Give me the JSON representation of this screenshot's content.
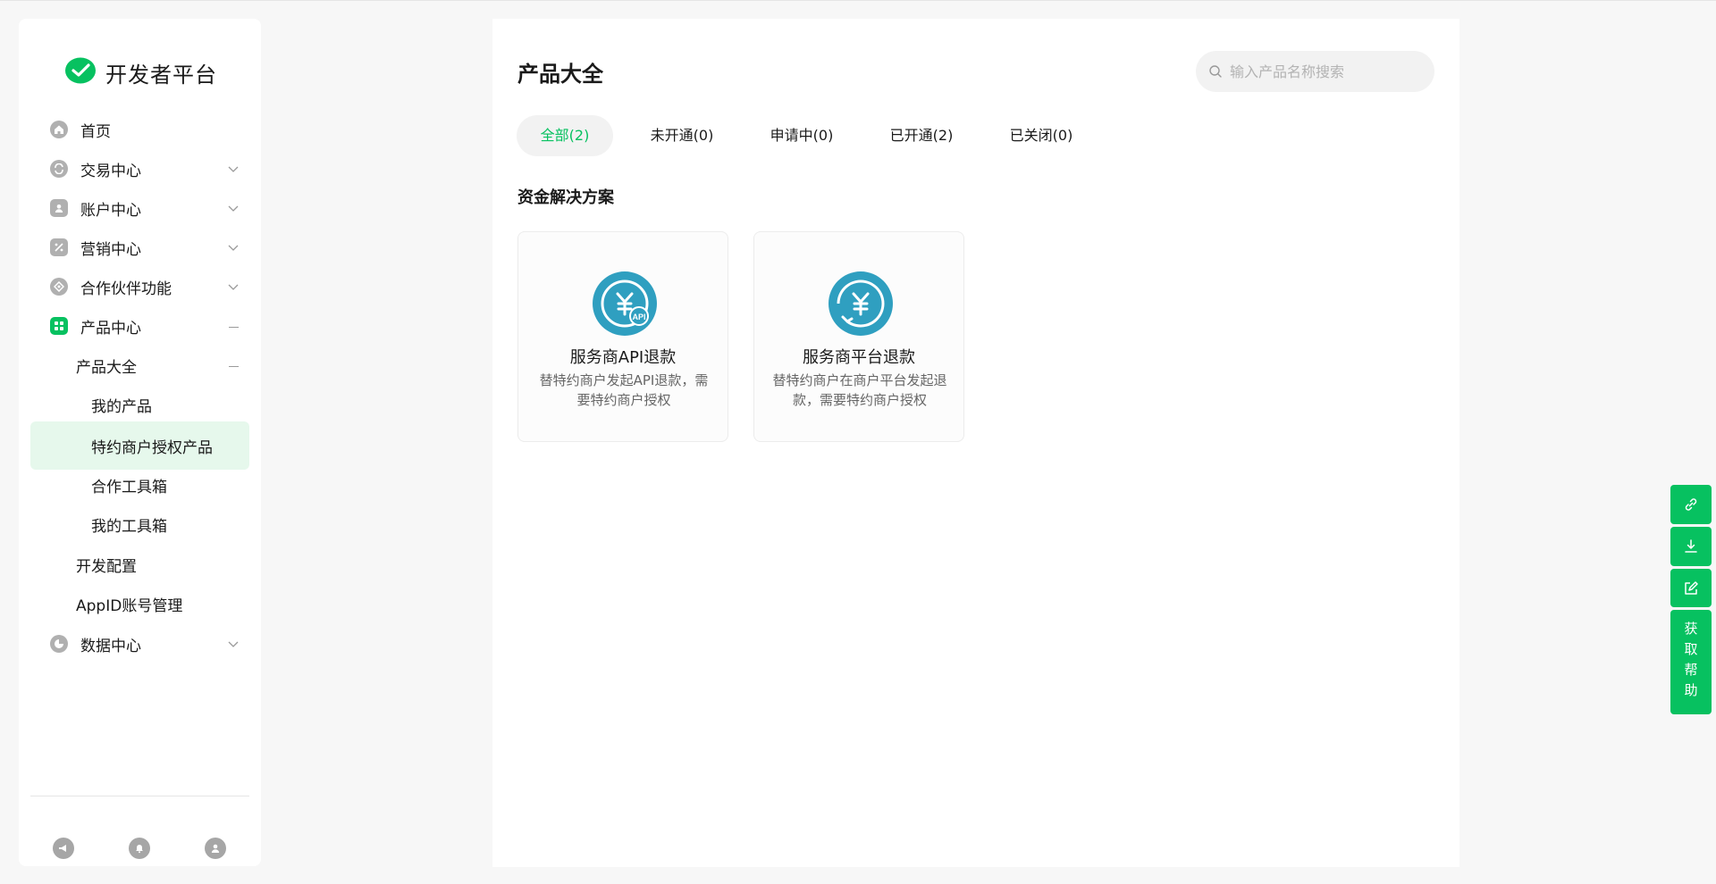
{
  "logo": {
    "text": "开发者平台"
  },
  "sidebar": {
    "items": [
      {
        "label": "首页",
        "icon": "home-icon"
      },
      {
        "label": "交易中心",
        "icon": "exchange-icon"
      },
      {
        "label": "账户中心",
        "icon": "account-icon"
      },
      {
        "label": "营销中心",
        "icon": "discount-icon"
      },
      {
        "label": "合作伙伴功能",
        "icon": "partner-icon"
      },
      {
        "label": "产品中心",
        "icon": "grid-icon"
      },
      {
        "label": "产品大全"
      },
      {
        "label": "我的产品"
      },
      {
        "label": "特约商户授权产品"
      },
      {
        "label": "合作工具箱"
      },
      {
        "label": "我的工具箱"
      },
      {
        "label": "开发配置"
      },
      {
        "label": "AppID账号管理"
      },
      {
        "label": "数据中心",
        "icon": "chart-icon"
      }
    ],
    "footer_icons": [
      "announcement-icon",
      "notification-icon",
      "user-icon"
    ]
  },
  "main": {
    "title": "产品大全",
    "search_placeholder": "输入产品名称搜索",
    "tabs": [
      {
        "label": "全部(2)"
      },
      {
        "label": "未开通(0)"
      },
      {
        "label": "申请中(0)"
      },
      {
        "label": "已开通(2)"
      },
      {
        "label": "已关闭(0)"
      }
    ],
    "section_title": "资金解决方案",
    "cards": [
      {
        "name": "服务商API退款",
        "desc": "替特约商户发起API退款，需要特约商户授权",
        "icon": "yuan-api-icon"
      },
      {
        "name": "服务商平台退款",
        "desc": "替特约商户在商户平台发起退款，需要特约商户授权",
        "icon": "yuan-refund-icon"
      }
    ]
  },
  "float_toolbar": {
    "help_label": "获取帮助",
    "icons": [
      "link-icon",
      "download-icon",
      "edit-icon"
    ]
  },
  "colors": {
    "brand": "#07c160",
    "card_icon": "#2f9fc0",
    "active_bg": "#e6f8ec"
  }
}
